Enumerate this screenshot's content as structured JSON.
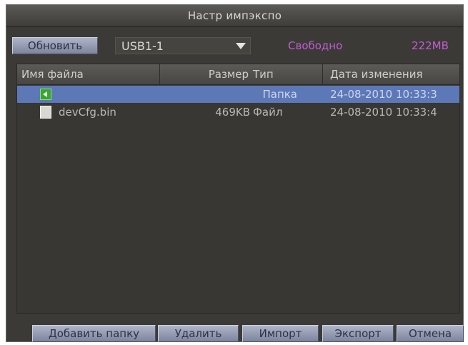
{
  "window": {
    "title": "Настр импэкспо"
  },
  "toolbar": {
    "refresh_label": "Обновить",
    "device": "USB1-1",
    "free_label": "Свободно",
    "free_value": "222MB"
  },
  "table": {
    "headers": {
      "name": "Имя файла",
      "size": "Размер",
      "type": "Тип",
      "date": "Дата изменения"
    },
    "rows": [
      {
        "icon": "folder-up-icon",
        "name": "",
        "size": "",
        "type": "Папка",
        "date": "24-08-2010 10:33:3",
        "selected": true
      },
      {
        "icon": "file-icon",
        "name": "devCfg.bin",
        "size": "469KB",
        "type": "Файл",
        "date": "24-08-2010 10:33:4",
        "selected": false
      }
    ]
  },
  "actions": {
    "add_folder": "Добавить папку",
    "delete": "Удалить",
    "import": "Импорт",
    "export": "Экспорт",
    "cancel": "Отмена"
  },
  "colors": {
    "accent_selected": "#5d78b7",
    "free_space_text": "#c65ad6",
    "button_face": "#9aa0b8"
  }
}
